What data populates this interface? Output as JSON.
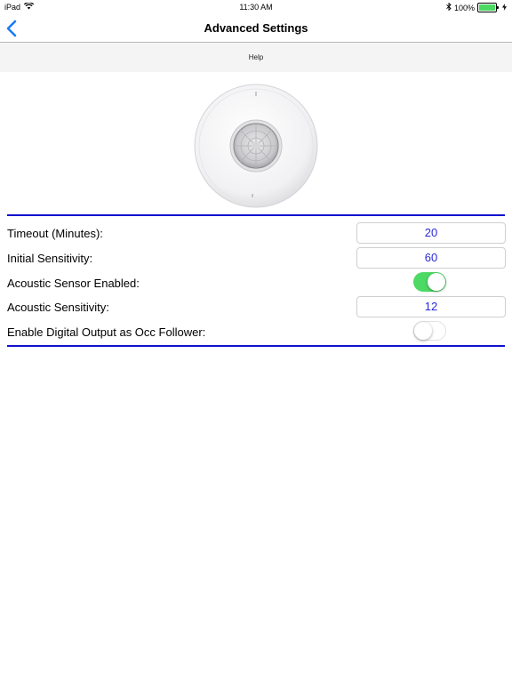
{
  "status_bar": {
    "device": "iPad",
    "time": "11:30 AM",
    "battery_percent": "100%",
    "battery_level": 1.0,
    "icons": [
      "wifi-icon",
      "bluetooth-icon",
      "battery-icon",
      "charging-icon"
    ]
  },
  "nav": {
    "title": "Advanced Settings",
    "back_icon": "chevron-left-icon"
  },
  "help": {
    "label": "Help"
  },
  "settings": {
    "timeout": {
      "label": "Timeout (Minutes):",
      "value": "20"
    },
    "initial_sensitivity": {
      "label": "Initial Sensitivity:",
      "value": "60"
    },
    "acoustic_enabled": {
      "label": "Acoustic Sensor Enabled:",
      "on": true
    },
    "acoustic_sensitivity": {
      "label": "Acoustic Sensitivity:",
      "value": "12"
    },
    "digital_output": {
      "label": "Enable Digital Output as Occ Follower:",
      "on": false
    }
  },
  "colors": {
    "accent": "#1a7cf5",
    "divider": "#1010d0",
    "value_text": "#2a2ad8",
    "toggle_on": "#4cd964"
  }
}
